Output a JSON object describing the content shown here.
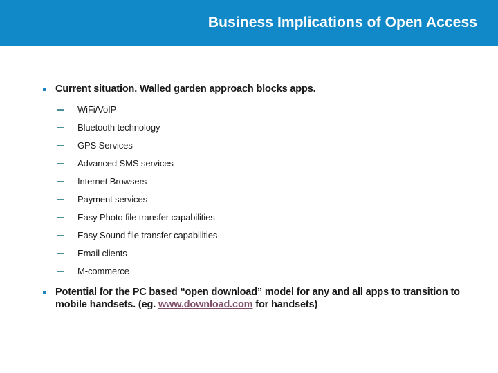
{
  "header": {
    "title": "Business Implications of Open Access",
    "background_color": "#1189c8",
    "title_color": "#ffffff"
  },
  "colors": {
    "bullet_dot": "#1f83c4",
    "dash_marker": "#4a8f96",
    "body_text": "#1a1a1a",
    "hyperlink": "#80506a",
    "slide_background": "#ffffff"
  },
  "body": {
    "bullet_1": {
      "text": "Current situation. Walled garden approach blocks apps.",
      "sub_items": [
        "WiFi/VoIP",
        "Bluetooth technology",
        "GPS Services",
        "Advanced SMS services",
        "Internet Browsers",
        "Payment services",
        "Easy Photo file transfer capabilities",
        "Easy Sound file transfer capabilities",
        "Email clients",
        "M-commerce"
      ]
    },
    "bullet_2": {
      "text_before_link": "Potential for the PC based “open download” model for any and all apps to transition to mobile handsets. (eg. ",
      "link_text": "www.download.com",
      "text_after_link": " for handsets)"
    }
  }
}
